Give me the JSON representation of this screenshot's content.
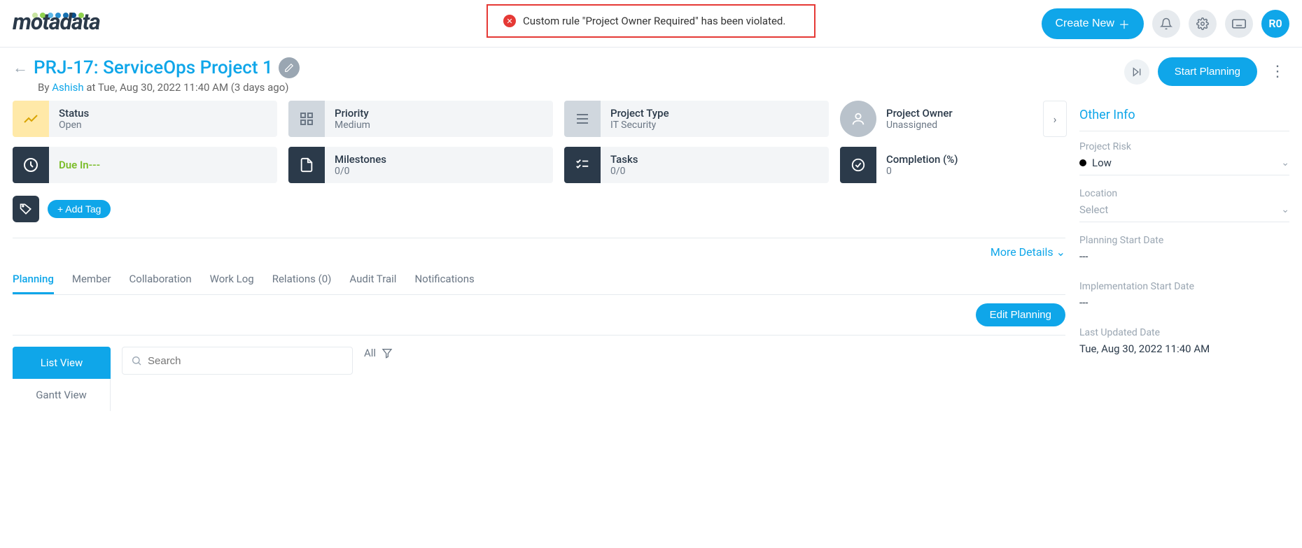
{
  "header": {
    "notification": "Custom rule \"Project Owner Required\" has been violated.",
    "create_new": "Create New",
    "avatar": "R0"
  },
  "title": {
    "back": "←",
    "text": "PRJ-17: ServiceOps Project 1",
    "by": "By",
    "author": "Ashish",
    "timestamp": "at Tue, Aug 30, 2022 11:40 AM (3 days ago)",
    "start_planning": "Start Planning"
  },
  "cards": {
    "status_label": "Status",
    "status_value": "Open",
    "priority_label": "Priority",
    "priority_value": "Medium",
    "type_label": "Project Type",
    "type_value": "IT Security",
    "owner_label": "Project Owner",
    "owner_value": "Unassigned",
    "due_label": "Due In---",
    "milestones_label": "Milestones",
    "milestones_value": "0/0",
    "tasks_label": "Tasks",
    "tasks_value": "0/0",
    "completion_label": "Completion (%)",
    "completion_value": "0"
  },
  "tags": {
    "add": "+ Add Tag"
  },
  "more_details": "More Details ⌄",
  "tabs": [
    "Planning",
    "Member",
    "Collaboration",
    "Work Log",
    "Relations (0)",
    "Audit Trail",
    "Notifications"
  ],
  "edit_planning": "Edit Planning",
  "views": {
    "list": "List View",
    "gantt": "Gantt View"
  },
  "search": {
    "placeholder": "Search",
    "all": "All"
  },
  "side": {
    "title": "Other Info",
    "risk_label": "Project Risk",
    "risk_value": "Low",
    "location_label": "Location",
    "location_value": "Select",
    "plan_start_label": "Planning Start Date",
    "plan_start_value": "---",
    "impl_start_label": "Implementation Start Date",
    "impl_start_value": "---",
    "updated_label": "Last Updated Date",
    "updated_value": "Tue, Aug 30, 2022 11:40 AM"
  }
}
